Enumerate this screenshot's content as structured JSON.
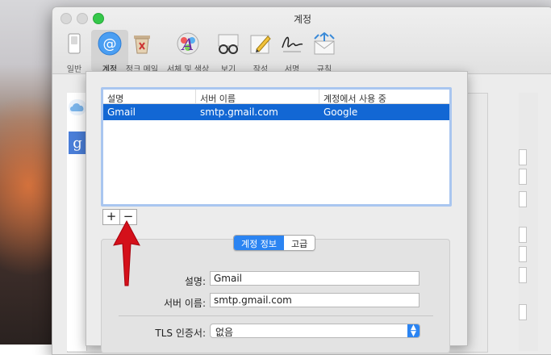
{
  "window": {
    "title": "계정"
  },
  "toolbar": {
    "items": [
      {
        "label": "일반",
        "icon": "switch-icon"
      },
      {
        "label": "계정",
        "icon": "at-sign-icon"
      },
      {
        "label": "정크 메일",
        "icon": "trash-junk-icon"
      },
      {
        "label": "서체 및 색상",
        "icon": "fonts-colors-icon"
      },
      {
        "label": "보기",
        "icon": "glasses-icon"
      },
      {
        "label": "작성",
        "icon": "compose-pencil-icon"
      },
      {
        "label": "서명",
        "icon": "signature-icon"
      },
      {
        "label": "규칙",
        "icon": "rules-envelope-icon"
      }
    ],
    "active_index": 1
  },
  "smtp_sheet": {
    "columns": [
      "설명",
      "서버 이름",
      "계정에서 사용 중"
    ],
    "rows": [
      {
        "description": "Gmail",
        "server": "smtp.gmail.com",
        "in_use_by": "Google"
      }
    ],
    "add_label": "+",
    "remove_label": "−",
    "tabs": {
      "account_info": "계정 정보",
      "advanced": "고급"
    },
    "form": {
      "description_label": "설명:",
      "description_value": "Gmail",
      "server_label": "서버 이름:",
      "server_value": "smtp.gmail.com",
      "tls_label": "TLS 인증서:",
      "tls_value": "없음"
    }
  },
  "colors": {
    "accent": "#2b84f2",
    "selection": "#1267d4",
    "arrow": "#d4101a"
  }
}
